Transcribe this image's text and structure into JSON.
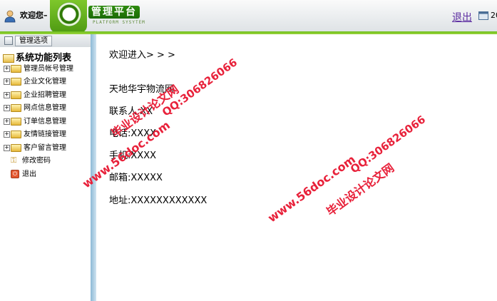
{
  "header": {
    "welcome": "欢迎您–",
    "brand_title": "管理平台",
    "brand_subtitle": "PLATFORM SYSYTEM",
    "logout": "退出",
    "date_fragment": "20"
  },
  "sidebar": {
    "header_button": "管理选项",
    "root": "系统功能列表",
    "items": [
      {
        "label": "管理员帐号管理"
      },
      {
        "label": "企业文化管理"
      },
      {
        "label": "企业招聘管理"
      },
      {
        "label": "网点信息管理"
      },
      {
        "label": "订单信息管理"
      },
      {
        "label": "友情链接管理"
      },
      {
        "label": "客户留言管理"
      },
      {
        "label": "修改密码"
      },
      {
        "label": "退出"
      }
    ]
  },
  "main": {
    "breadcrumb": "欢迎进入> > >",
    "company": "天地华宇物流网",
    "contact": "联系人:XX",
    "phone": "电话:XXXX",
    "mobile": "手机:XXXX",
    "email": "邮箱:XXXXX",
    "address": "地址:XXXXXXXXXXXX"
  },
  "watermarks": {
    "site": "www.56doc.com",
    "qq": "QQ:306826066",
    "brand": "毕业设计论文网"
  },
  "colors": {
    "accent_green": "#6fbf1e",
    "link_purple": "#5b2ca0",
    "watermark_red": "#e8213a",
    "sidebar_strip": "#a9cde3"
  }
}
